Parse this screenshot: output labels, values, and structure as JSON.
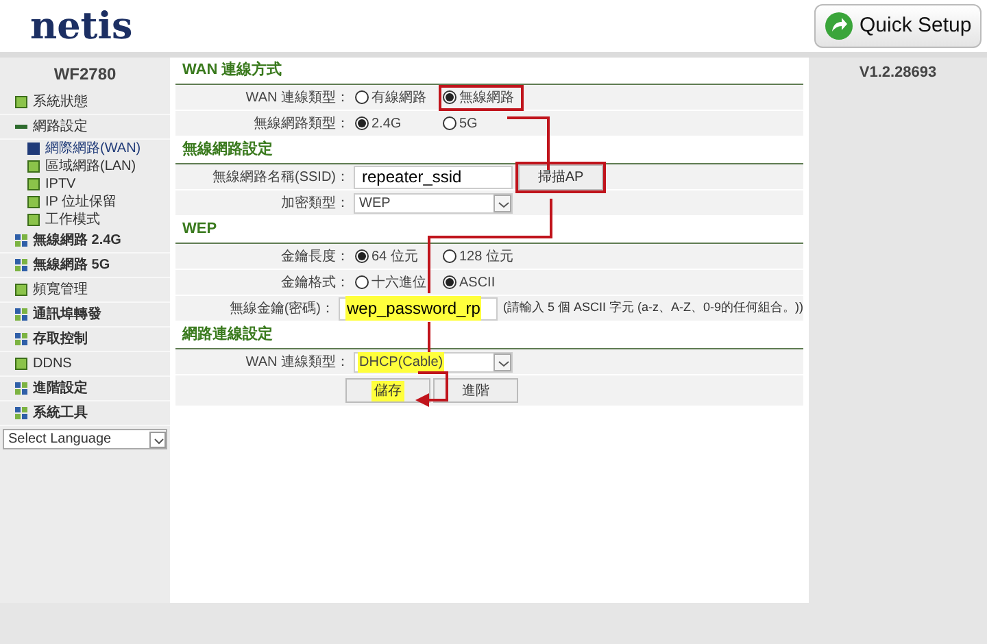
{
  "header": {
    "logo": "netis",
    "quick_setup": "Quick Setup"
  },
  "sidebar": {
    "model": "WF2780",
    "items": [
      {
        "label": "系統狀態",
        "kind": "page",
        "expanded": false
      },
      {
        "label": "網路設定",
        "kind": "page",
        "expanded": true,
        "children": [
          {
            "label": "網際網路(WAN)",
            "selected": true
          },
          {
            "label": "區域網路(LAN)",
            "selected": false
          },
          {
            "label": "IPTV",
            "selected": false
          },
          {
            "label": "IP 位址保留",
            "selected": false
          },
          {
            "label": "工作模式",
            "selected": false
          }
        ]
      },
      {
        "label": "無線網路 2.4G",
        "kind": "group",
        "expanded": false
      },
      {
        "label": "無線網路 5G",
        "kind": "group",
        "expanded": false
      },
      {
        "label": "頻寬管理",
        "kind": "page",
        "expanded": false
      },
      {
        "label": "通訊埠轉發",
        "kind": "group",
        "expanded": false
      },
      {
        "label": "存取控制",
        "kind": "group",
        "expanded": false
      },
      {
        "label": "DDNS",
        "kind": "page",
        "expanded": false
      },
      {
        "label": "進階設定",
        "kind": "group",
        "expanded": false
      },
      {
        "label": "系統工具",
        "kind": "group",
        "expanded": false
      }
    ],
    "language": "Select Language"
  },
  "version": "V1.2.28693",
  "sections": [
    {
      "title": "WAN 連線方式",
      "rows": [
        {
          "kind": "radio",
          "label": "WAN 連線類型：",
          "options": [
            {
              "label": "有線網路",
              "selected": false,
              "outlined": false
            },
            {
              "label": "無線網路",
              "selected": true,
              "outlined": true
            }
          ]
        },
        {
          "kind": "radio",
          "label": "無線網路類型：",
          "options": [
            {
              "label": "2.4G",
              "selected": true,
              "outlined": false
            },
            {
              "label": "5G",
              "selected": false,
              "outlined": false
            }
          ]
        }
      ]
    },
    {
      "title": "無線網路設定",
      "rows": [
        {
          "kind": "text",
          "label": "無線網路名稱(SSID)：",
          "value": "repeater_ssid",
          "highlighted": false,
          "button": {
            "label": "掃描AP",
            "outlined": true
          }
        },
        {
          "kind": "select",
          "label": "加密類型：",
          "value": "WEP",
          "highlighted": false
        }
      ]
    },
    {
      "title": "WEP",
      "rows": [
        {
          "kind": "radio",
          "label": "金鑰長度：",
          "options": [
            {
              "label": "64 位元",
              "selected": true,
              "outlined": false
            },
            {
              "label": "128 位元",
              "selected": false,
              "outlined": false
            }
          ]
        },
        {
          "kind": "radio",
          "label": "金鑰格式：",
          "options": [
            {
              "label": "十六進位",
              "selected": false,
              "outlined": false
            },
            {
              "label": "ASCII",
              "selected": true,
              "outlined": false
            }
          ]
        },
        {
          "kind": "text",
          "label": "無線金鑰(密碼)：",
          "value": "wep_password_rp",
          "highlighted": true,
          "hint": "(請輸入 5 個 ASCII 字元 (a-z、A-Z、0-9的任何組合。))"
        }
      ]
    },
    {
      "title": "網路連線設定",
      "rows": [
        {
          "kind": "select",
          "label": "WAN 連線類型：",
          "value": "DHCP(Cable)",
          "highlighted": true
        }
      ]
    }
  ],
  "buttons": [
    {
      "label": "儲存",
      "highlighted": true
    },
    {
      "label": "進階",
      "highlighted": false
    }
  ]
}
